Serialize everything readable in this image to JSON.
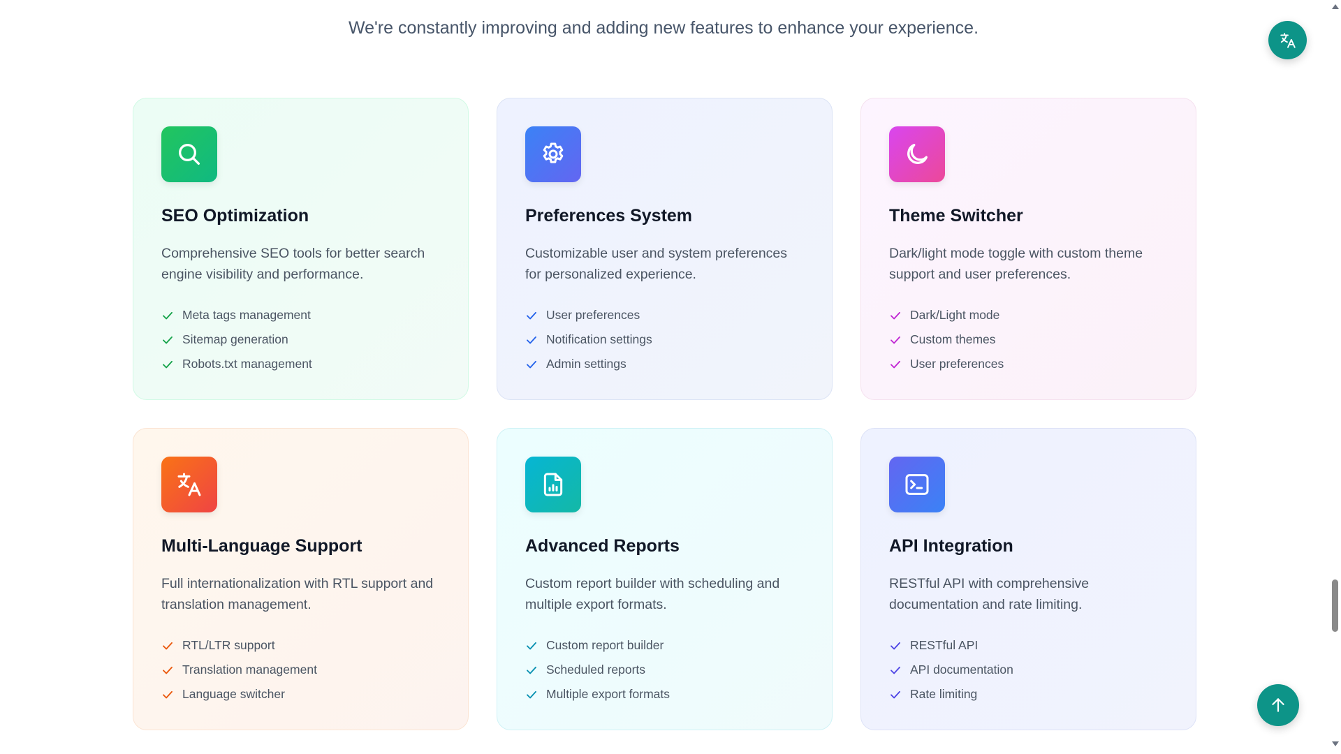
{
  "header": {
    "subtitle": "We're constantly improving and adding new features to enhance your experience."
  },
  "cards": [
    {
      "title": "SEO Optimization",
      "description": "Comprehensive SEO tools for better search engine visibility and performance.",
      "icon": "search-icon",
      "accent": "#16a34a",
      "features": [
        "Meta tags management",
        "Sitemap generation",
        "Robots.txt management"
      ]
    },
    {
      "title": "Preferences System",
      "description": "Customizable user and system preferences for personalized experience.",
      "icon": "gear-icon",
      "accent": "#2563eb",
      "features": [
        "User preferences",
        "Notification settings",
        "Admin settings"
      ]
    },
    {
      "title": "Theme Switcher",
      "description": "Dark/light mode toggle with custom theme support and user preferences.",
      "icon": "moon-icon",
      "accent": "#c026d3",
      "features": [
        "Dark/Light mode",
        "Custom themes",
        "User preferences"
      ]
    },
    {
      "title": "Multi-Language Support",
      "description": "Full internationalization with RTL support and translation management.",
      "icon": "translate-icon",
      "accent": "#ea580c",
      "features": [
        "RTL/LTR support",
        "Translation management",
        "Language switcher"
      ]
    },
    {
      "title": "Advanced Reports",
      "description": "Custom report builder with scheduling and multiple export formats.",
      "icon": "report-file-icon",
      "accent": "#0891b2",
      "features": [
        "Custom report builder",
        "Scheduled reports",
        "Multiple export formats"
      ]
    },
    {
      "title": "API Integration",
      "description": "RESTful API with comprehensive documentation and rate limiting.",
      "icon": "terminal-icon",
      "accent": "#4f46e5",
      "features": [
        "RESTful API",
        "API documentation",
        "Rate limiting"
      ]
    }
  ],
  "floating": {
    "translate_button_icon": "translate-icon",
    "scroll_top_icon": "arrow-up-icon",
    "brand_color": "#0d9488"
  }
}
